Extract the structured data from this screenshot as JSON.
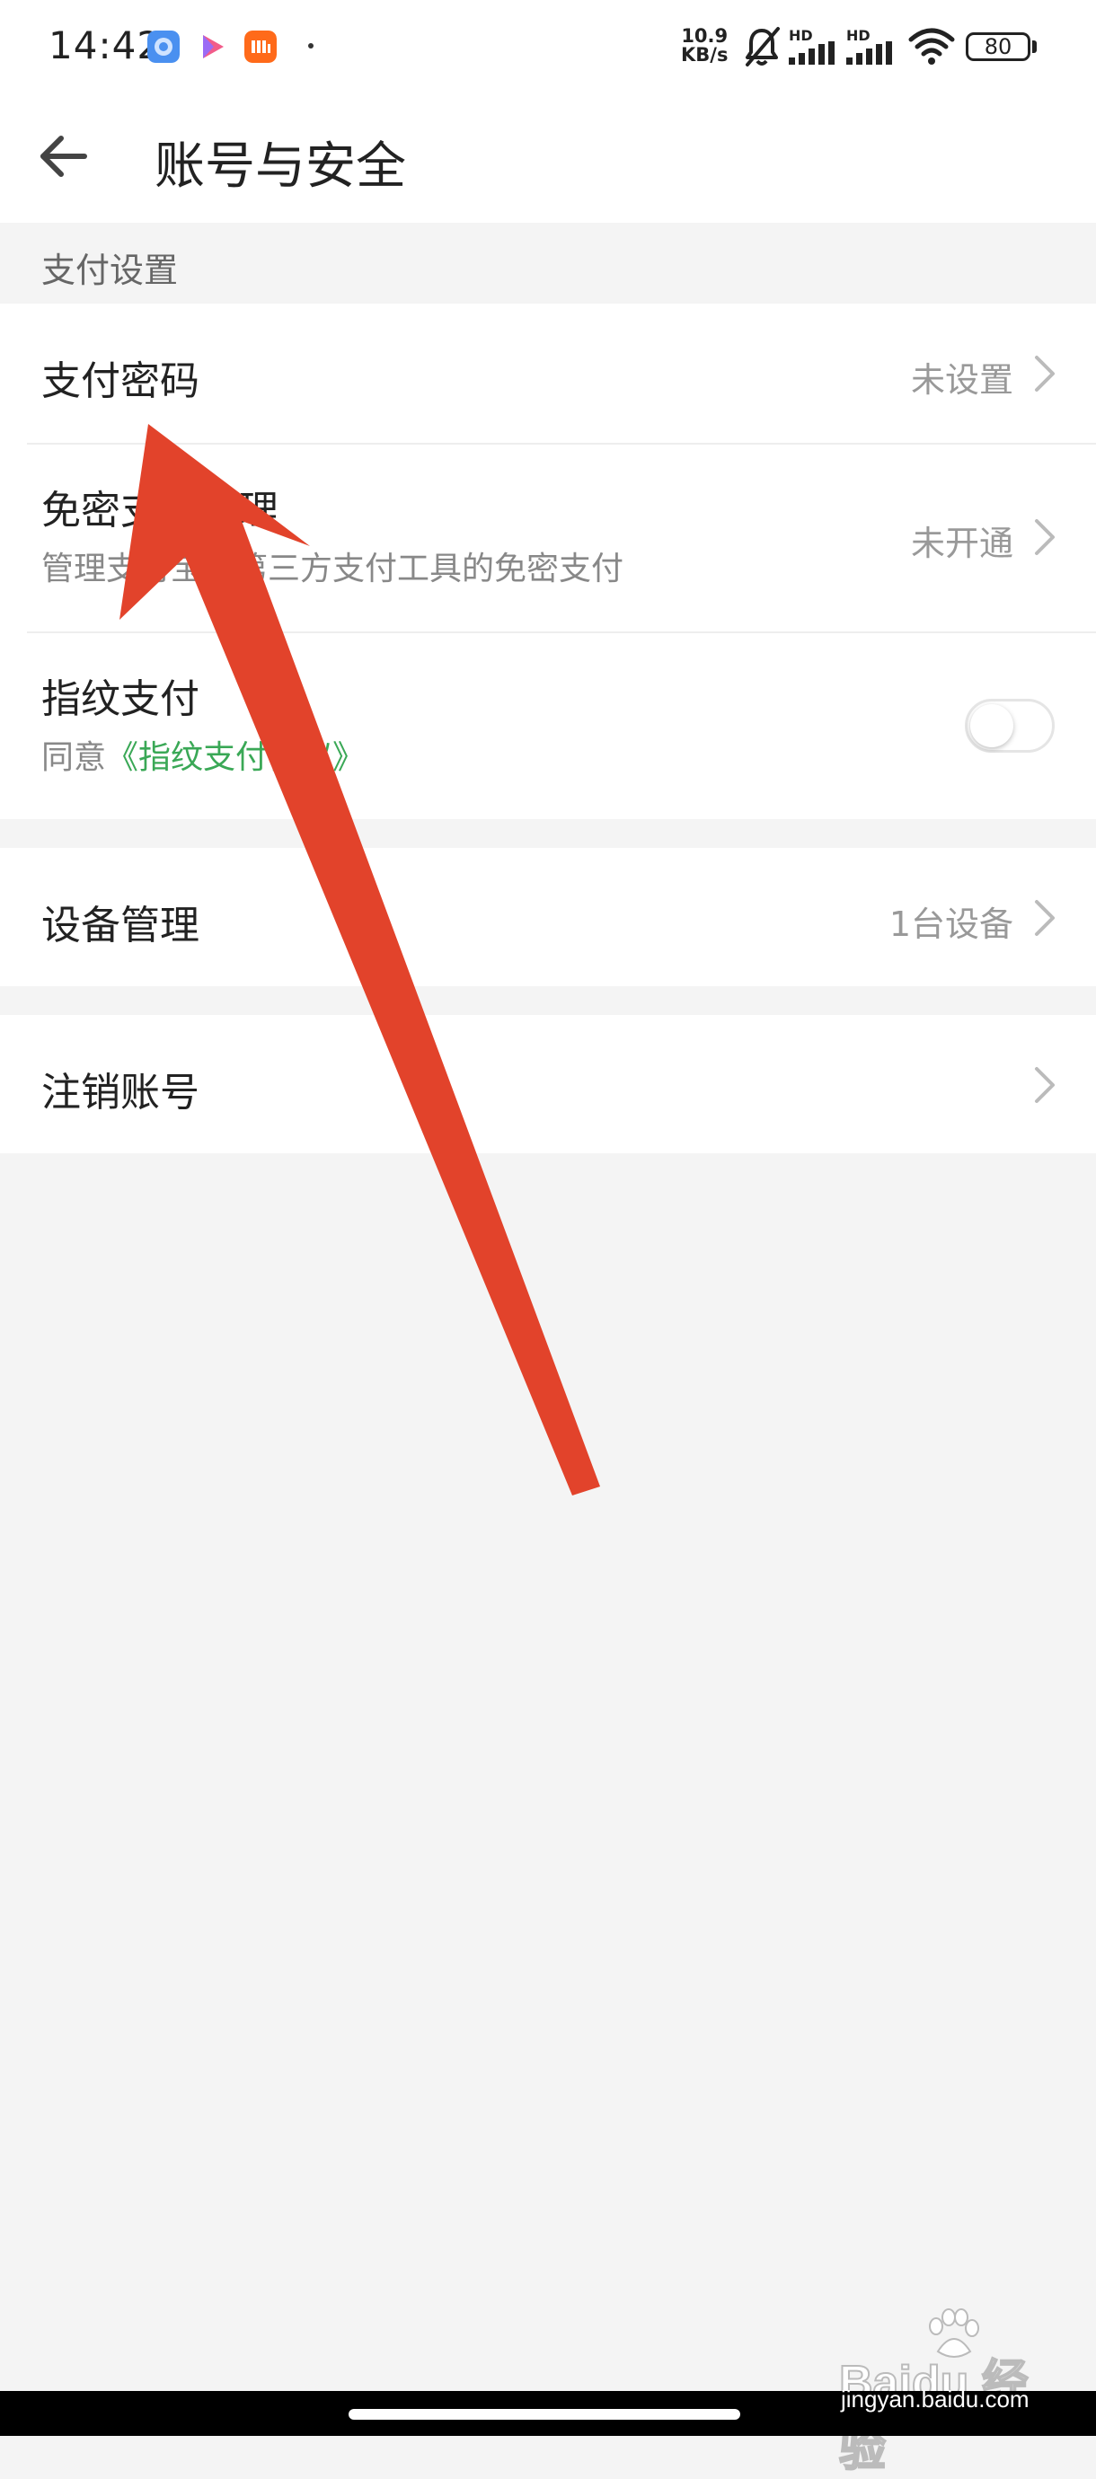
{
  "status_bar": {
    "time": "14:42",
    "net_speed_value": "10.9",
    "net_speed_unit": "KB/s",
    "hd1": "HD",
    "hd2": "HD",
    "battery": "80"
  },
  "header": {
    "title": "账号与安全",
    "back_icon": "arrow-left-icon"
  },
  "payment_settings": {
    "section_label": "支付设置",
    "items": [
      {
        "title": "支付密码",
        "value": "未设置"
      },
      {
        "title": "免密支付管理",
        "subtitle": "管理支付宝等第三方支付工具的免密支付",
        "value": "未开通"
      },
      {
        "title": "指纹支付",
        "subtitle_prefix": "同意",
        "subtitle_link": "《指纹支付协议》",
        "toggle_on": false
      }
    ]
  },
  "device": {
    "title": "设备管理",
    "value": "1台设备"
  },
  "account": {
    "title": "注销账号"
  },
  "watermark": {
    "brand": "Baidu 经验",
    "site": "jingyan.baidu.com"
  },
  "colors": {
    "accent_green": "#3aa856",
    "annotation_arrow": "#e2432b",
    "background": "#f4f4f4"
  }
}
